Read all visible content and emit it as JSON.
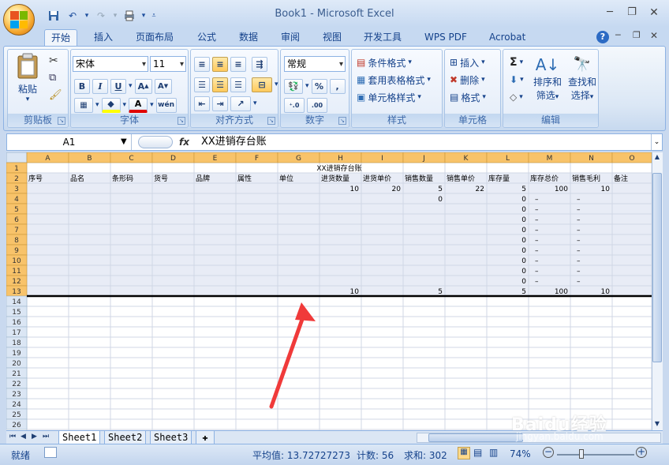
{
  "window": {
    "title": "Book1 - Microsoft Excel"
  },
  "tabs": [
    "开始",
    "插入",
    "页面布局",
    "公式",
    "数据",
    "审阅",
    "视图",
    "开发工具",
    "WPS PDF",
    "Acrobat"
  ],
  "ribbon": {
    "clipboard": {
      "label": "剪贴板",
      "paste": "粘贴"
    },
    "font": {
      "label": "字体",
      "name": "宋体",
      "size": "11",
      "bold": "B",
      "italic": "I",
      "underline": "U"
    },
    "align": {
      "label": "对齐方式"
    },
    "number": {
      "label": "数字",
      "format": "常规",
      "percent": "%",
      "comma": ","
    },
    "styles": {
      "label": "样式",
      "cond": "条件格式",
      "table": "套用表格格式",
      "cell": "单元格样式"
    },
    "cells": {
      "label": "单元格",
      "insert": "插入",
      "delete": "删除",
      "format": "格式"
    },
    "edit": {
      "label": "编辑",
      "sigma": "Σ",
      "sort": "排序和",
      "sort2": "筛选",
      "find": "查找和",
      "find2": "选择"
    }
  },
  "formula_bar": {
    "name_box": "A1",
    "fx": "fx",
    "content": "XX进销存台账"
  },
  "columns": [
    "A",
    "B",
    "C",
    "D",
    "E",
    "F",
    "G",
    "H",
    "I",
    "J",
    "K",
    "L",
    "M",
    "N",
    "O"
  ],
  "sheet": {
    "title": "XX进销存台账",
    "headers": [
      "序号",
      "品名",
      "条形码",
      "货号",
      "品牌",
      "属性",
      "单位",
      "进货数量",
      "进货单价",
      "销售数量",
      "销售单价",
      "库存量",
      "库存总价",
      "销售毛利",
      "备注"
    ],
    "rows": [
      {
        "r": 3,
        "cells": {
          "H": "10",
          "I": "20",
          "J": "5",
          "K": "22",
          "L": "5",
          "M": "100",
          "N": "10"
        }
      },
      {
        "r": 4,
        "cells": {
          "J": "0",
          "L": "0",
          "M": "–",
          "N": "–"
        }
      },
      {
        "r": 5,
        "cells": {
          "L": "0",
          "M": "–",
          "N": "–"
        }
      },
      {
        "r": 6,
        "cells": {
          "L": "0",
          "M": "–",
          "N": "–"
        }
      },
      {
        "r": 7,
        "cells": {
          "L": "0",
          "M": "–",
          "N": "–"
        }
      },
      {
        "r": 8,
        "cells": {
          "L": "0",
          "M": "–",
          "N": "–"
        }
      },
      {
        "r": 9,
        "cells": {
          "L": "0",
          "M": "–",
          "N": "–"
        }
      },
      {
        "r": 10,
        "cells": {
          "L": "0",
          "M": "–",
          "N": "–"
        }
      },
      {
        "r": 11,
        "cells": {
          "L": "0",
          "M": "–",
          "N": "–"
        }
      },
      {
        "r": 12,
        "cells": {
          "L": "0",
          "M": "–",
          "N": "–"
        }
      },
      {
        "r": 13,
        "cells": {
          "H": "10",
          "J": "5",
          "L": "5",
          "M": "100",
          "N": "10"
        }
      }
    ],
    "row_count": 26
  },
  "sheet_tabs": [
    "Sheet1",
    "Sheet2",
    "Sheet3"
  ],
  "status": {
    "ready": "就绪",
    "average": "平均值: 13.72727273",
    "count": "计数: 56",
    "sum": "求和: 302",
    "zoom": "74%"
  },
  "watermark": {
    "text": "Baidu经验",
    "url": "jingyan.baidu.com"
  },
  "colors": {
    "accent": "#15428b",
    "header_bg": "#dbe6f4",
    "selection": "#e8ecf6",
    "header_selected": "#f8c36a",
    "arrow": "#f03a3a"
  }
}
